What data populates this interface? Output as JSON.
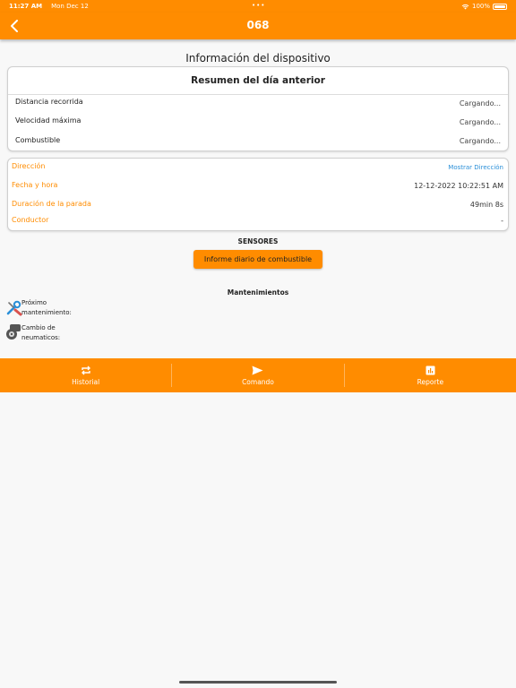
{
  "status_bar": {
    "time": "11:27 AM",
    "date": "Mon Dec 12",
    "battery": "100%"
  },
  "app_bar": {
    "title": "068"
  },
  "page": {
    "title": "Información del dispositivo"
  },
  "summary": {
    "title": "Resumen del día anterior",
    "rows": [
      {
        "label": "Distancia recorrida",
        "value": "Cargando..."
      },
      {
        "label": "Velocidad máxima",
        "value": "Cargando..."
      },
      {
        "label": "Combustible",
        "value": "Cargando..."
      }
    ]
  },
  "info": {
    "rows": [
      {
        "label": "Dirección",
        "value": "Mostrar Dirección"
      },
      {
        "label": "Fecha y hora",
        "value": "12-12-2022 10:22:51 AM"
      },
      {
        "label": "Duración de la parada",
        "value": "49min 8s"
      },
      {
        "label": "Conductor",
        "value": "-"
      }
    ]
  },
  "sensors": {
    "title": "SENSORES",
    "fuel_button": "Informe diario de combustible"
  },
  "maintenance": {
    "title": "Mantenimientos",
    "items": [
      {
        "label": "Próximo mantenimiento:",
        "icon": "wrench-icon"
      },
      {
        "label": "Cambio de neumaticos:",
        "icon": "tire-icon"
      }
    ]
  },
  "bottom_nav": {
    "items": [
      {
        "label": "Historial",
        "icon": "repeat-icon"
      },
      {
        "label": "Comando",
        "icon": "send-icon"
      },
      {
        "label": "Reporte",
        "icon": "report-icon"
      }
    ]
  },
  "colors": {
    "accent": "#ff8c00",
    "link": "#2a8fd8"
  }
}
